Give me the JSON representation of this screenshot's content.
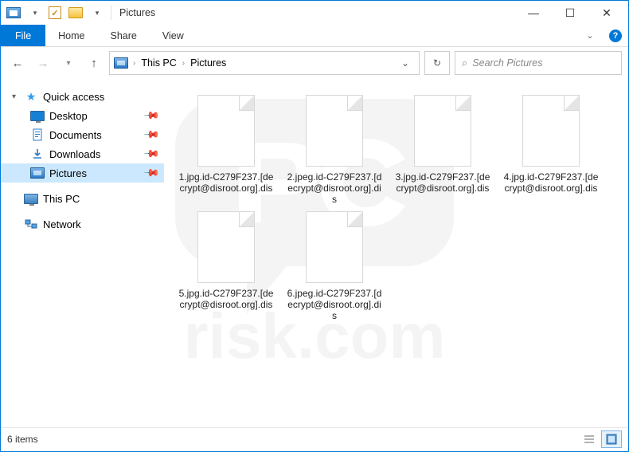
{
  "titlebar": {
    "title": "Pictures",
    "checkbox_checked": true
  },
  "window_controls": {
    "minimize": "—",
    "maximize": "☐",
    "close": "✕"
  },
  "ribbon": {
    "file": "File",
    "tabs": [
      "Home",
      "Share",
      "View"
    ]
  },
  "address": {
    "crumbs": [
      "This PC",
      "Pictures"
    ],
    "search_placeholder": "Search Pictures"
  },
  "sidebar": {
    "quick_access": {
      "label": "Quick access",
      "items": [
        {
          "label": "Desktop",
          "pinned": true
        },
        {
          "label": "Documents",
          "pinned": true
        },
        {
          "label": "Downloads",
          "pinned": true
        },
        {
          "label": "Pictures",
          "pinned": true,
          "selected": true
        }
      ]
    },
    "this_pc": "This PC",
    "network": "Network"
  },
  "files": [
    {
      "name": "1.jpg.id-C279F237.[decrypt@disroot.org].dis"
    },
    {
      "name": "2.jpeg.id-C279F237.[decrypt@disroot.org].dis"
    },
    {
      "name": "3.jpg.id-C279F237.[decrypt@disroot.org].dis"
    },
    {
      "name": "4.jpg.id-C279F237.[decrypt@disroot.org].dis"
    },
    {
      "name": "5.jpg.id-C279F237.[decrypt@disroot.org].dis"
    },
    {
      "name": "6.jpeg.id-C279F237.[decrypt@disroot.org].dis"
    }
  ],
  "statusbar": {
    "count_text": "6 items"
  },
  "watermark": "PC risk.com"
}
